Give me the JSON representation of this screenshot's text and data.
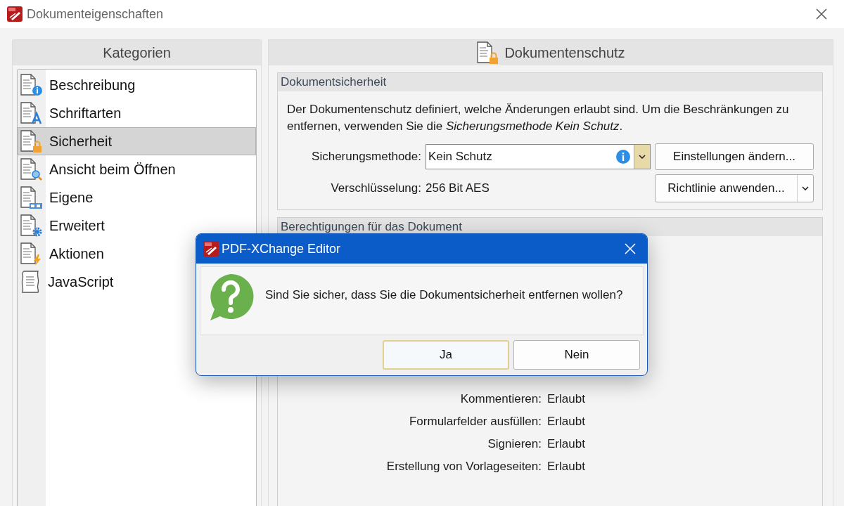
{
  "window": {
    "title": "Dokumenteigenschaften"
  },
  "sidebar": {
    "title": "Kategorien",
    "items": [
      {
        "label": "Beschreibung",
        "kind": "info",
        "selected": false
      },
      {
        "label": "Schriftarten",
        "kind": "font",
        "selected": false
      },
      {
        "label": "Sicherheit",
        "kind": "lock",
        "selected": true
      },
      {
        "label": "Ansicht beim Öffnen",
        "kind": "search",
        "selected": false
      },
      {
        "label": "Eigene",
        "kind": "form",
        "selected": false
      },
      {
        "label": "Erweitert",
        "kind": "gear",
        "selected": false
      },
      {
        "label": "Aktionen",
        "kind": "bolt",
        "selected": false
      },
      {
        "label": "JavaScript",
        "kind": "script",
        "selected": false
      }
    ]
  },
  "panel": {
    "title": "Dokumentenschutz",
    "security": {
      "title": "Dokumentsicherheit",
      "description": "Der Dokumentenschutz definiert, welche Änderungen erlaubt sind. Um die Beschränkungen zu entfernen, verwenden Sie die *Sicherungsmethode Kein Schutz*.",
      "method_label": "Sicherungsmethode:",
      "method_value": "Kein Schutz",
      "change_button": "Einstellungen ändern...",
      "encryption_label": "Verschlüsselung:",
      "encryption_value": "256 Bit AES",
      "policy_button": "Richtlinie anwenden..."
    },
    "permissions": {
      "title": "Berechtigungen für das Dokument",
      "rows": [
        {
          "label": "Kommentieren:",
          "value": "Erlaubt"
        },
        {
          "label": "Formularfelder ausfüllen:",
          "value": "Erlaubt"
        },
        {
          "label": "Signieren:",
          "value": "Erlaubt"
        },
        {
          "label": "Erstellung von Vorlageseiten:",
          "value": "Erlaubt"
        }
      ]
    }
  },
  "dialog": {
    "title": "PDF-XChange Editor",
    "message": "Sind Sie sicher, dass Sie die Dokumentsicherheit entfernen wollen?",
    "buttons": [
      {
        "label": "Ja",
        "focused": true
      },
      {
        "label": "Nein",
        "focused": false
      }
    ]
  }
}
